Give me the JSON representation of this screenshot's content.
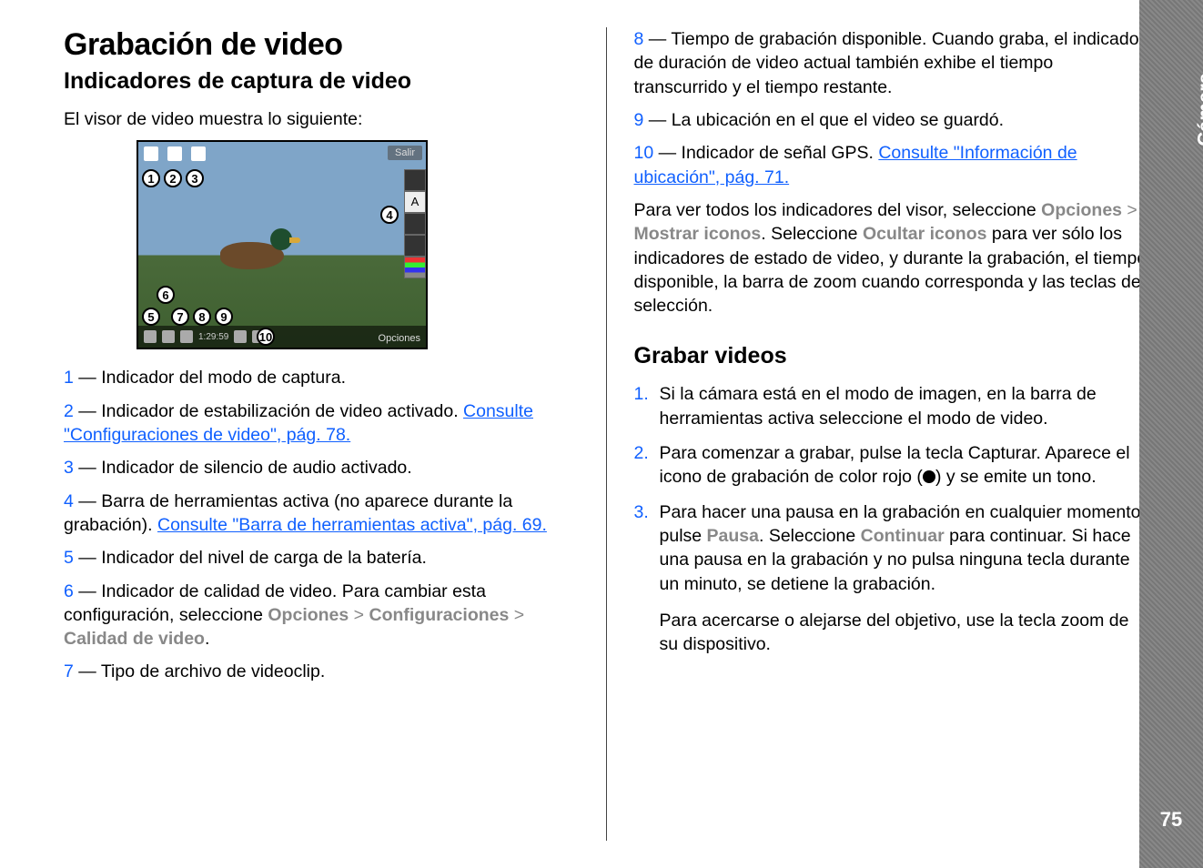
{
  "sidebar": {
    "section_label": "Cámara",
    "page_number": "75"
  },
  "left": {
    "h1": "Grabación de video",
    "h2": "Indicadores de captura de video",
    "intro": "El visor de video muestra lo siguiente:",
    "viewfinder": {
      "salir": "Salir",
      "opciones": "Opciones",
      "time": "1:29:59",
      "callouts": {
        "1": "1",
        "2": "2",
        "3": "3",
        "4": "4",
        "5": "5",
        "6": "6",
        "7": "7",
        "8": "8",
        "9": "9",
        "10": "10"
      },
      "toolbar_letter": "A"
    },
    "items": {
      "i1": {
        "n": "1",
        "t": " — Indicador del modo de captura."
      },
      "i2": {
        "n": "2",
        "t": " — Indicador de estabilización de video activado. ",
        "link": "Consulte \"Configuraciones de video\", pág. 78."
      },
      "i3": {
        "n": "3",
        "t": " — Indicador de silencio de audio activado."
      },
      "i4": {
        "n": "4",
        "t": " — Barra de herramientas activa (no aparece durante la grabación). ",
        "link": "Consulte \"Barra de herramientas activa\", pág. 69."
      },
      "i5": {
        "n": "5",
        "t": " — Indicador del nivel de carga de la batería."
      },
      "i6": {
        "n": "6",
        "t1": " — Indicador de calidad de video. Para cambiar esta configuración, seleccione ",
        "u1": "Opciones",
        "gt1": " > ",
        "u2": "Configuraciones",
        "gt2": " > ",
        "u3": "Calidad de video",
        "tail": "."
      },
      "i7": {
        "n": "7",
        "t": " — Tipo de archivo de videoclip."
      }
    }
  },
  "right": {
    "items": {
      "i8": {
        "n": "8",
        "t": " — Tiempo de grabación disponible. Cuando graba, el indicador de duración de video actual también exhibe el tiempo transcurrido y el tiempo restante."
      },
      "i9": {
        "n": "9",
        "t": " — La ubicación en el que el video se guardó."
      },
      "i10": {
        "n": "10",
        "t": " — Indicador de señal GPS. ",
        "link": "Consulte \"Información de ubicación\", pág. 71."
      }
    },
    "para": {
      "a": "Para ver todos los indicadores del visor, seleccione ",
      "u1": "Opciones",
      "gt": " > ",
      "u2": "Mostrar iconos",
      "b": ". Seleccione ",
      "u3": "Ocultar iconos",
      "c": " para ver sólo los indicadores de estado de video, y durante la grabación, el tiempo disponible, la barra de zoom cuando corresponda y las teclas de selección."
    },
    "h2": "Grabar videos",
    "steps": {
      "s1": {
        "n": "1.",
        "t": "Si la cámara está en el modo de imagen, en la barra de herramientas activa seleccione el modo de video."
      },
      "s2": {
        "n": "2.",
        "a": "Para comenzar a grabar, pulse la tecla Capturar. Aparece el icono de grabación de color rojo (",
        "b": ") y se emite un tono."
      },
      "s3": {
        "n": "3.",
        "a": "Para hacer una pausa en la grabación en cualquier momento, pulse ",
        "u1": "Pausa",
        "b": ". Seleccione ",
        "u2": "Continuar",
        "c": " para continuar. Si hace una pausa en la grabación y no pulsa ninguna tecla durante un minuto, se detiene la grabación."
      },
      "extra": "Para acercarse o alejarse del objetivo, use la tecla zoom de su dispositivo."
    }
  }
}
